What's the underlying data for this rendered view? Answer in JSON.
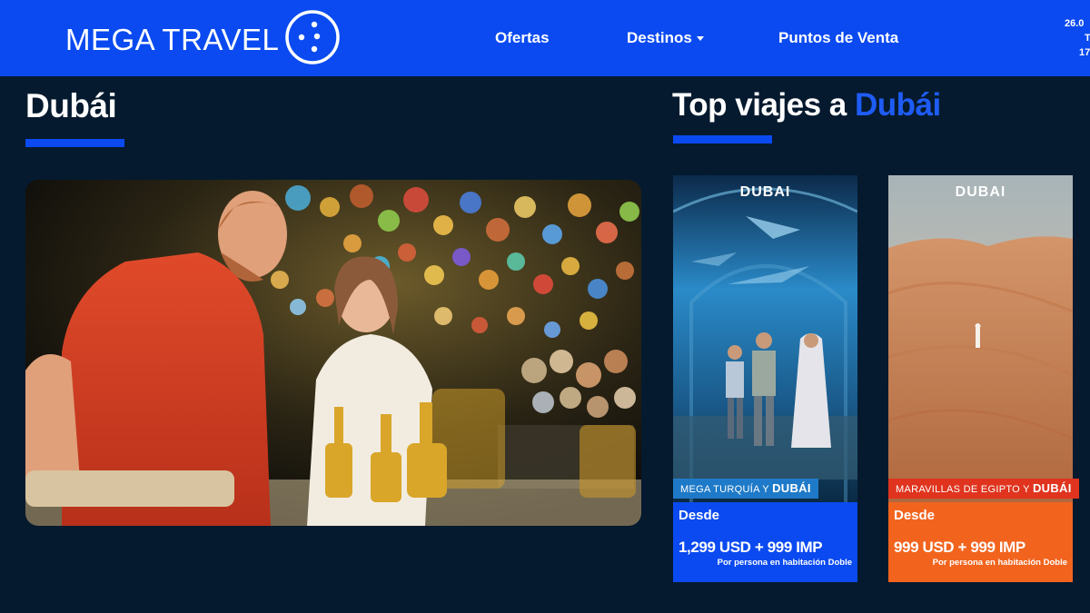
{
  "header": {
    "brand": "MEGA TRAVEL",
    "nav": [
      {
        "label": "Ofertas",
        "has_caret": false
      },
      {
        "label": "Destinos",
        "has_caret": true
      },
      {
        "label": "Puntos de Venta",
        "has_caret": false
      }
    ],
    "clock_lines": [
      "26.0",
      "T",
      "17"
    ],
    "colors": {
      "brand_blue": "#0a4af0",
      "background": "#051a2e"
    }
  },
  "main": {
    "title": "Dubái",
    "top_title_prefix": "Top viajes a",
    "top_title_highlight": "Dubái"
  },
  "cards": [
    {
      "image_logo": "DUBAI",
      "tag_prefix": "MEGA TURQUÍA Y",
      "tag_highlight": "DUBÁI",
      "desde": "Desde",
      "price": "1,299 USD + 999 IMP",
      "note": "Por persona en habitación Doble",
      "color": "#0a4af0"
    },
    {
      "image_logo": "DUBAI",
      "tag_prefix": "MARAVILLAS DE EGIPTO Y",
      "tag_highlight": "DUBÁI",
      "desde": "Desde",
      "price": "999 USD + 999 IMP",
      "note": "Por persona en habitación Doble",
      "color": "#f2641e"
    }
  ]
}
